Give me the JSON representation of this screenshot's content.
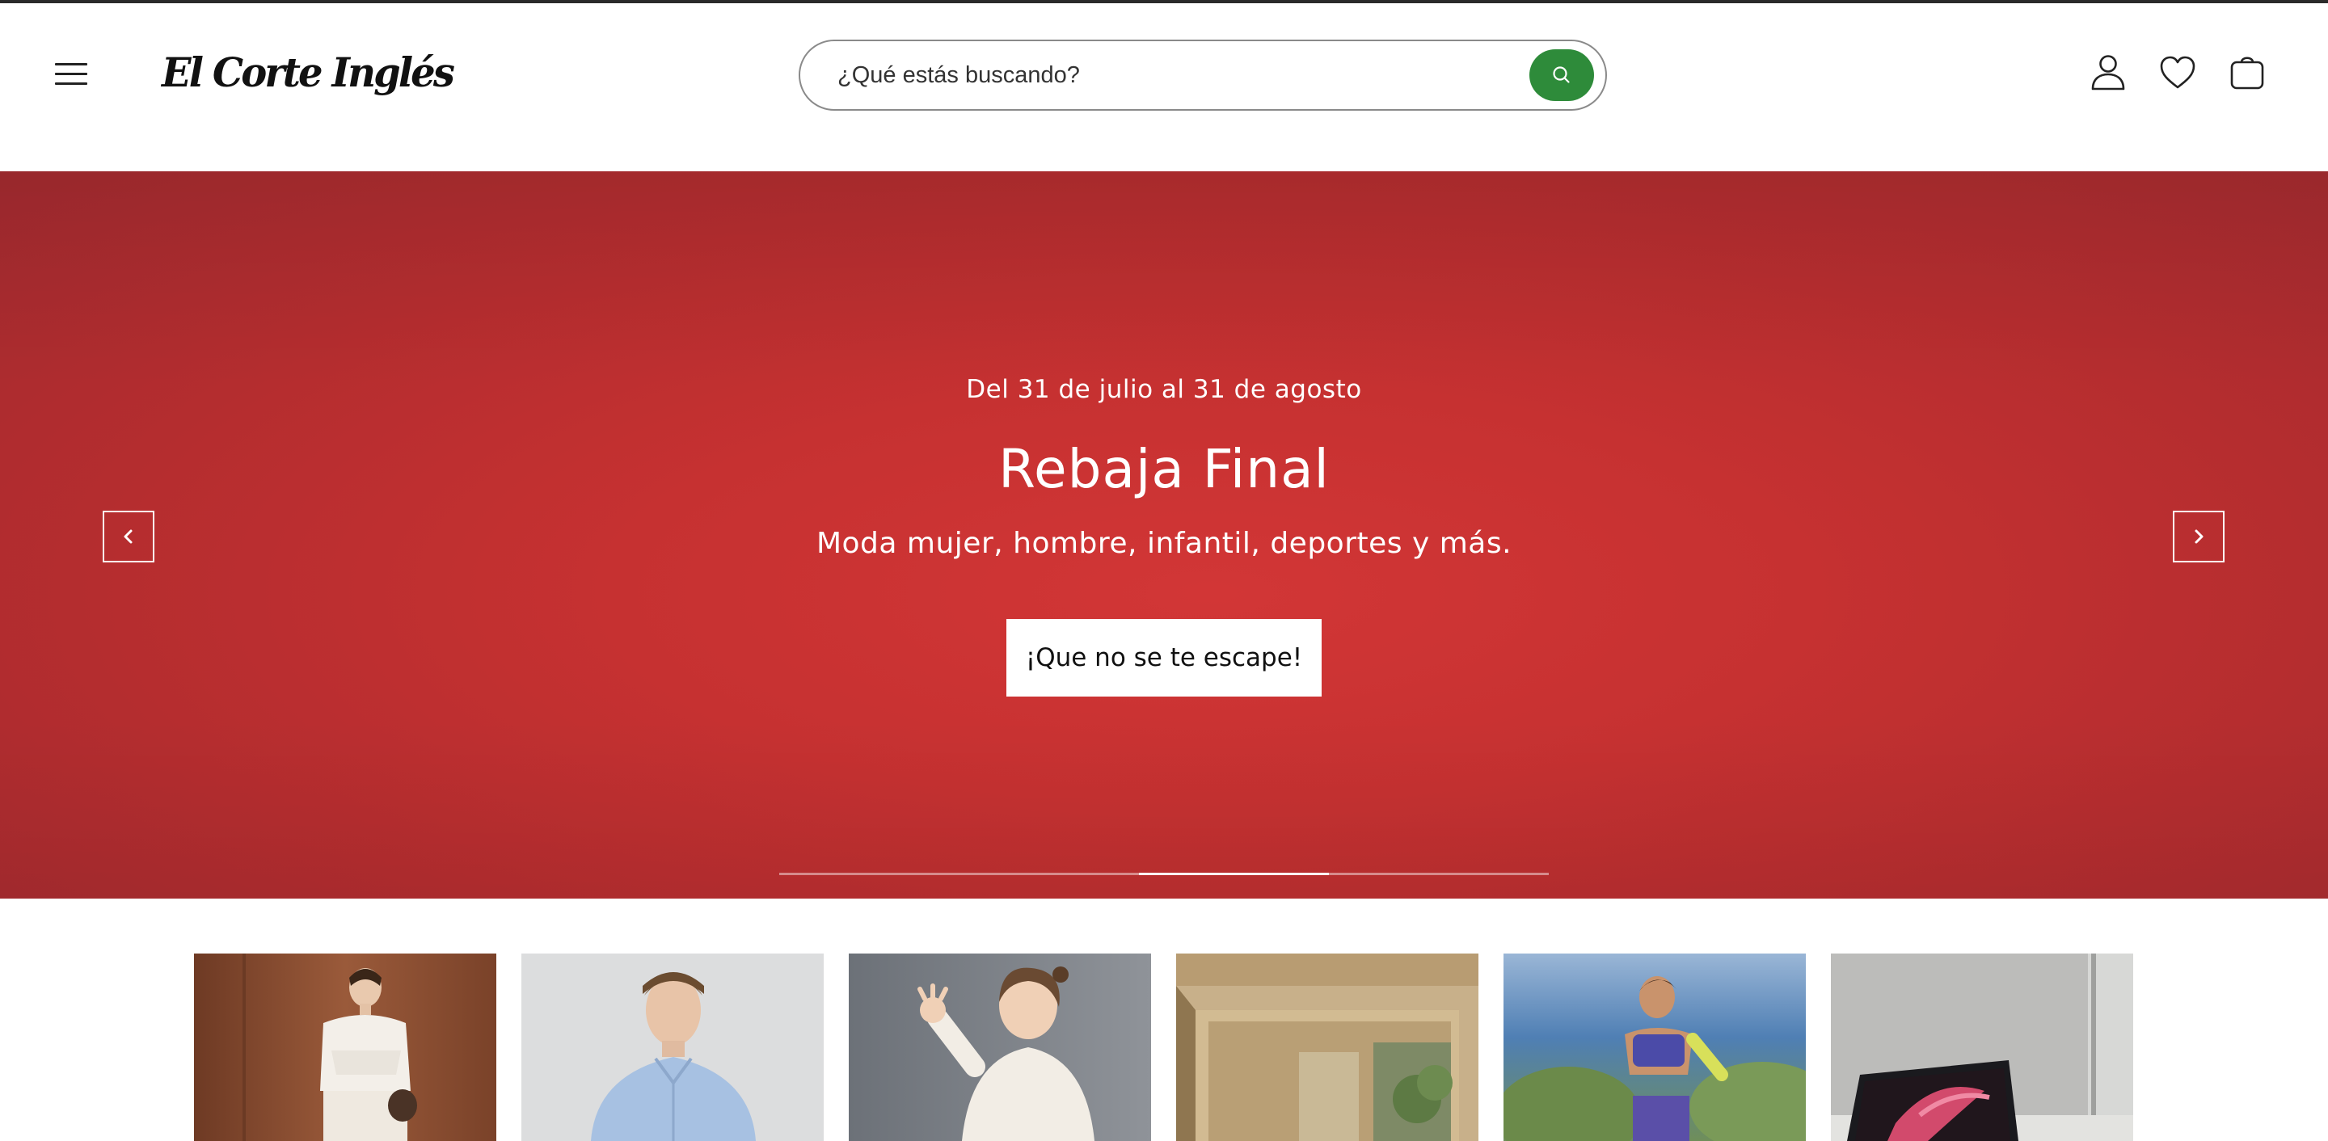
{
  "header": {
    "logo_text": "El Corte Inglés",
    "menu_icon": "hamburger-menu-icon",
    "search": {
      "placeholder": "¿Qué estás buscando?",
      "button_icon": "search-icon",
      "button_color": "#2e8b3a"
    },
    "icons": [
      "user-icon",
      "heart-icon",
      "shopping-bag-icon"
    ]
  },
  "hero": {
    "date_range": "Del 31 de julio al 31 de agosto",
    "title": "Rebaja Final",
    "subtitle": "Moda mujer, hombre, infantil, deportes y más.",
    "cta_label": "¡Que no se te escape!",
    "background_color": "#c63131",
    "prev_icon": "chevron-left-icon",
    "next_icon": "chevron-right-icon",
    "carousel_progress": {
      "active_index": 2,
      "slide_count": 4
    }
  },
  "category_tiles": [
    {
      "id": "mujer",
      "image": "woman-in-white-top-photo",
      "color": "#8a4e33"
    },
    {
      "id": "hombre",
      "image": "man-in-blue-shirt-photo",
      "color": "#d9dadb"
    },
    {
      "id": "infantil",
      "image": "smiling-girl-waving-photo",
      "color": "#7d8187"
    },
    {
      "id": "hogar",
      "image": "interior-doorway-photo",
      "color": "#b59a6d"
    },
    {
      "id": "deportes",
      "image": "woman-running-outdoors-photo",
      "color": "#5c86b8"
    },
    {
      "id": "tecnologia",
      "image": "laptop-on-desk-photo",
      "color": "#b8b9b7"
    }
  ]
}
